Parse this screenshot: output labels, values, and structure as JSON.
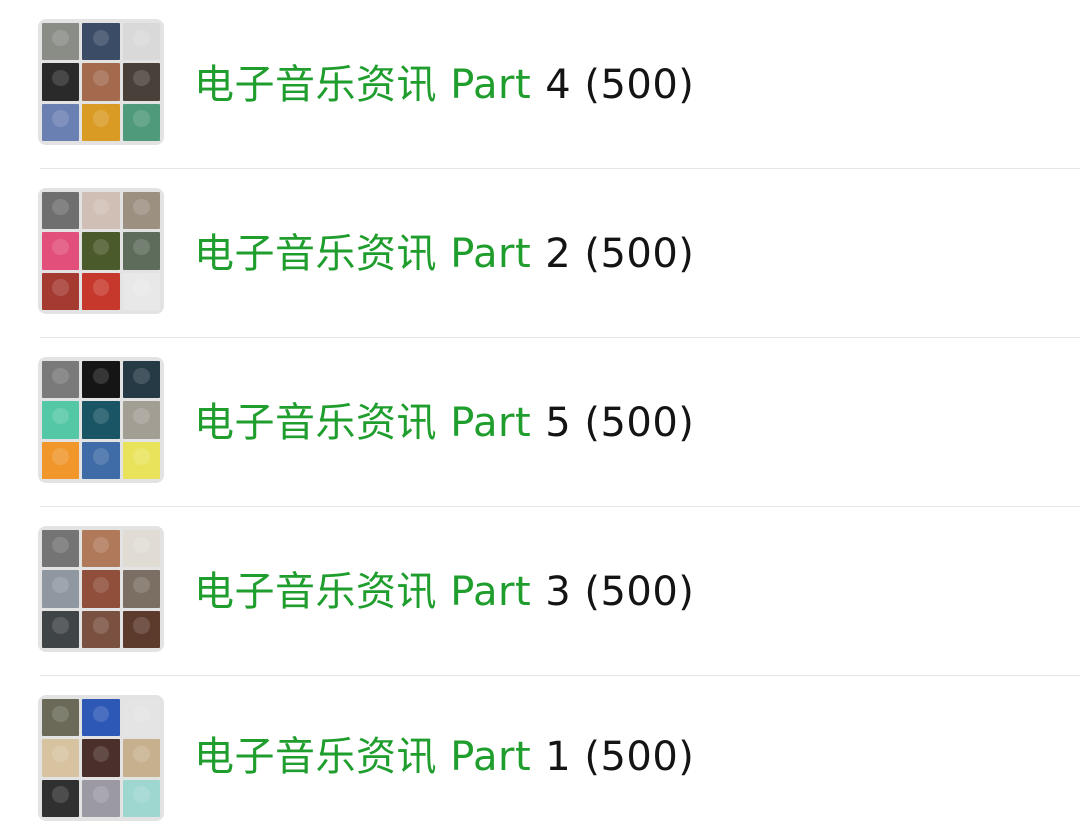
{
  "groups": [
    {
      "name": "电子音乐资讯 Part",
      "count": "4 (500)",
      "avatar_colors": [
        "#8a8d86",
        "#3b4c67",
        "#d9d9d9",
        "#2a2a2a",
        "#a46a4e",
        "#4a403a",
        "#6a7fb2",
        "#d99b24",
        "#4f9a7b"
      ]
    },
    {
      "name": "电子音乐资讯 Part",
      "count": "2 (500)",
      "avatar_colors": [
        "#6f6f6f",
        "#d0bfb4",
        "#9c9081",
        "#e24f7a",
        "#4b5a2a",
        "#5d6c5b",
        "#a53a31",
        "#c7382c",
        "#e8e8e8"
      ]
    },
    {
      "name": "电子音乐资讯 Part",
      "count": "5 (500)",
      "avatar_colors": [
        "#7a7a7a",
        "#151515",
        "#263a46",
        "#54c8a6",
        "#1a5565",
        "#a39e94",
        "#f0962b",
        "#3f6ca6",
        "#e8e35a"
      ]
    },
    {
      "name": "电子音乐资讯 Part",
      "count": "3 (500)",
      "avatar_colors": [
        "#747474",
        "#b07a5a",
        "#e0dcd4",
        "#8f97a1",
        "#8f4f3a",
        "#7b6f63",
        "#3f4447",
        "#7a5140",
        "#5c3b2c"
      ]
    },
    {
      "name": "电子音乐资讯 Part",
      "count": "1 (500)",
      "avatar_colors": [
        "#6b6a58",
        "#2e58b6",
        "#e4e4e4",
        "#d8c3a1",
        "#4a2f2a",
        "#c7b08e",
        "#303030",
        "#9b9aa3",
        "#9ed6d0"
      ]
    }
  ],
  "colors": {
    "group_name": "#1f9d2d",
    "count": "#141414",
    "divider": "#e6e6e6",
    "avatar_bg": "#e3e3e3"
  }
}
